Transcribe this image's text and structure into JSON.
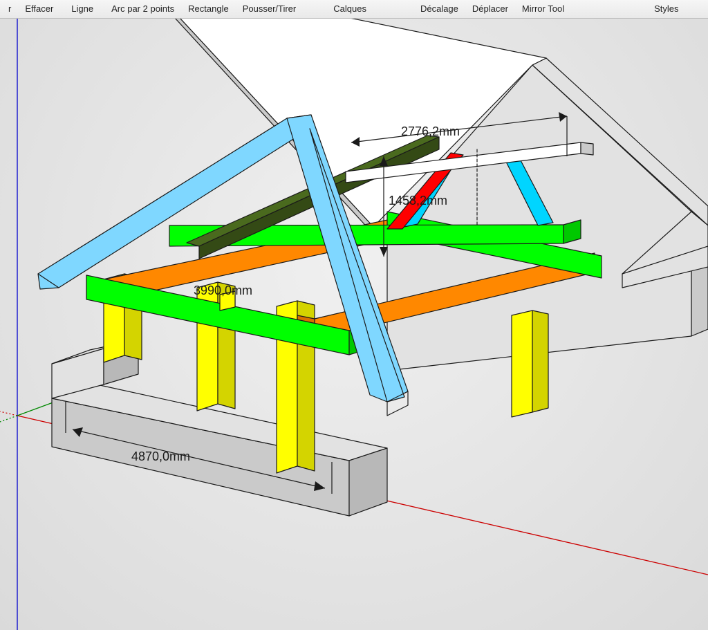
{
  "toolbar": {
    "items": [
      "r",
      "Effacer",
      "Ligne",
      "Arc par 2 points",
      "Rectangle",
      "Pousser/Tirer",
      "Calques",
      "Décalage",
      "Déplacer",
      "Mirror Tool",
      "Styles"
    ]
  },
  "dimensions": {
    "d1": "2776,2mm",
    "d2": "1458,2mm",
    "d3": "3990,0mm",
    "d4": "4870,0mm"
  },
  "colors": {
    "post": "#ffff00",
    "beam_horizontal": "#00ff00",
    "beam_cross": "#ff8800",
    "ridge": "#4a6a1e",
    "rafter_left": "#7fd7ff",
    "rafter_right": "#00d5ff",
    "brace": "#ff0000",
    "wall": "#ffffff"
  }
}
